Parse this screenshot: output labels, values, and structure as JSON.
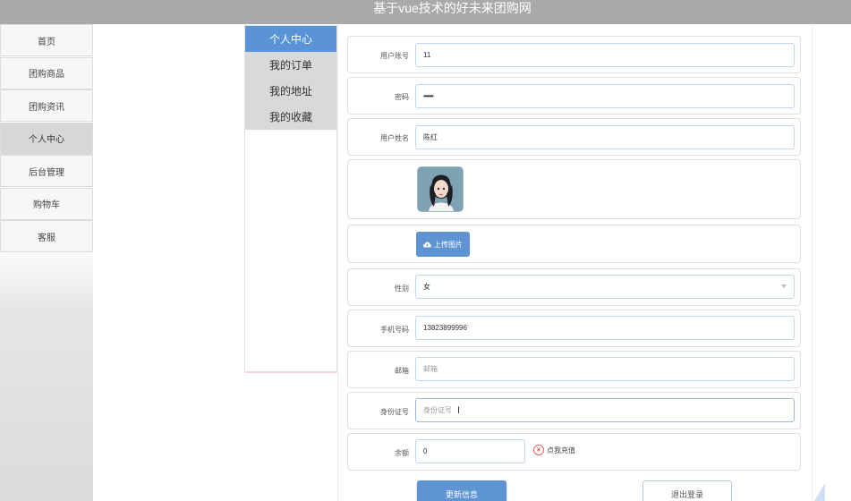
{
  "header": {
    "title": "基于vue技术的好未来团购网"
  },
  "left_nav": {
    "items": [
      {
        "label": "首页"
      },
      {
        "label": "团购商品"
      },
      {
        "label": "团购资讯"
      },
      {
        "label": "个人中心"
      },
      {
        "label": "后台管理"
      },
      {
        "label": "购物车"
      },
      {
        "label": "客服"
      }
    ],
    "active": "个人中心"
  },
  "sub_menu": {
    "items": [
      {
        "label": "个人中心"
      },
      {
        "label": "我的订单"
      },
      {
        "label": "我的地址"
      },
      {
        "label": "我的收藏"
      }
    ],
    "active": "个人中心"
  },
  "form": {
    "account": {
      "label": "用户账号",
      "value": "11"
    },
    "password": {
      "label": "密码",
      "value": "••••••"
    },
    "name": {
      "label": "用户姓名",
      "value": "陈红"
    },
    "avatar": {
      "icon": "user-avatar-image"
    },
    "upload": {
      "label": "上传图片",
      "icon": "cloud-upload-icon"
    },
    "gender": {
      "label": "性别",
      "value": "女"
    },
    "phone": {
      "label": "手机号码",
      "value": "13823899996"
    },
    "email": {
      "label": "邮箱",
      "placeholder": "邮箱"
    },
    "id_card": {
      "label": "身份证号",
      "placeholder": "身份证号"
    },
    "balance": {
      "label": "余额",
      "value": "0",
      "recharge_label": "点我充值",
      "recharge_icon": "¥"
    },
    "update_button": "更新信息",
    "logout_button": "退出登录"
  },
  "colors": {
    "accent": "#5e94d2",
    "header_bg": "#a8aaa9",
    "nav_active": "#d6d8d7",
    "submenu_active": "#5a93d6",
    "recharge_icon": "#d33333"
  }
}
